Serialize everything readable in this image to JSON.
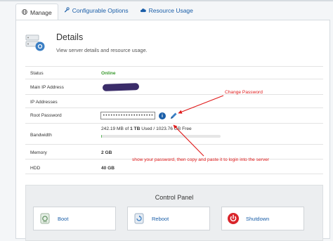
{
  "tabs": [
    {
      "label": "Manage",
      "icon": "globe-icon",
      "active": true
    },
    {
      "label": "Configurable Options",
      "icon": "wrench-icon",
      "active": false
    },
    {
      "label": "Resource Usage",
      "icon": "cloud-icon",
      "active": false
    }
  ],
  "details": {
    "title": "Details",
    "subtitle": "View server details and resource usage."
  },
  "rows": {
    "status": {
      "label": "Status",
      "value": "Online"
    },
    "main_ip": {
      "label": "Main IP Address"
    },
    "ip_addresses": {
      "label": "IP Addresses"
    },
    "root_password": {
      "label": "Root Password",
      "value": "••••••••••••••••••••••"
    },
    "bandwidth": {
      "label": "Bandwidth",
      "used_text": "242.19 MB of ",
      "total_text": "1 TB",
      "rest_text": " Used / 1023.76 GB Free",
      "used_fraction": 0.0002
    },
    "memory": {
      "label": "Memory",
      "value": "2 GB"
    },
    "hdd": {
      "label": "HDD",
      "value": "40 GB"
    }
  },
  "annotations": {
    "change_password": "Change Password",
    "show_password": "show your password, then copy and paste it to login into the server"
  },
  "control_panel": {
    "title": "Control Panel",
    "boot": "Boot",
    "reboot": "Reboot",
    "shutdown": "Shutdown"
  },
  "colors": {
    "link": "#1a5ea8",
    "online": "#3a9a2f",
    "annotation": "#e01b1b",
    "shutdown": "#d9242a"
  }
}
